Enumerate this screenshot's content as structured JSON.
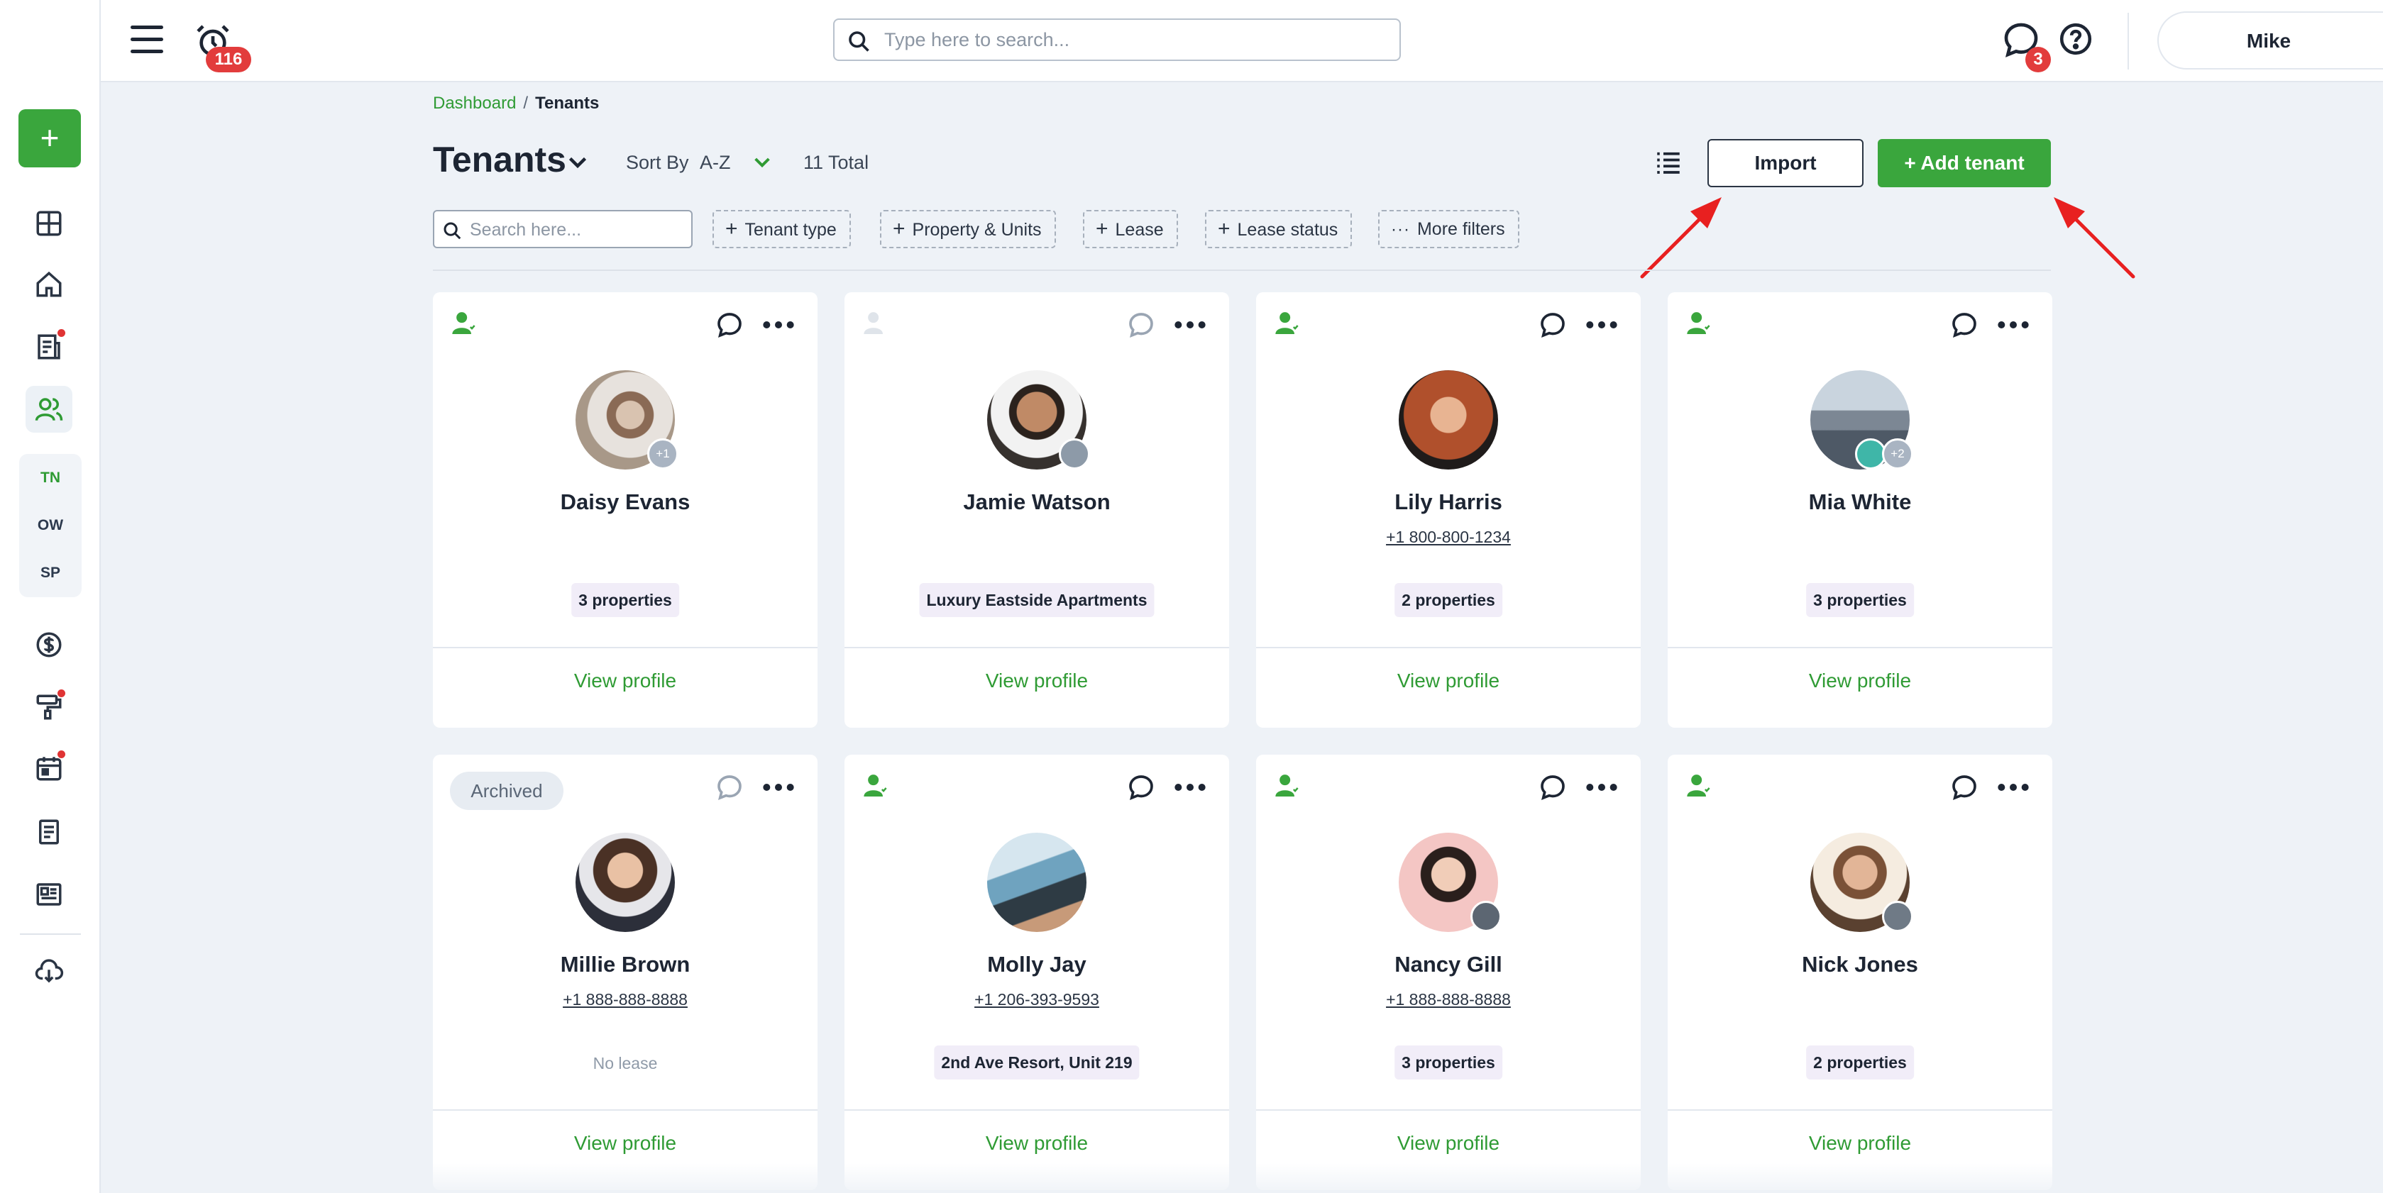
{
  "topbar": {
    "alarm_count": "116",
    "search_placeholder": "Type here to search...",
    "messages_count": "3",
    "user_name": "Mike"
  },
  "sidebar": {
    "add_label": "+",
    "sub_items": [
      "TN",
      "OW",
      "SP"
    ]
  },
  "breadcrumb": {
    "root": "Dashboard",
    "sep": "/",
    "current": "Tenants"
  },
  "header": {
    "title": "Tenants",
    "sort_label": "Sort By",
    "sort_value": "A-Z",
    "total": "11 Total",
    "import_label": "Import",
    "add_label": "+  Add tenant"
  },
  "filters": {
    "search_placeholder": "Search here...",
    "chips": [
      "Tenant type",
      "Property & Units",
      "Lease",
      "Lease status",
      "More filters"
    ]
  },
  "cards": [
    {
      "name": "Daisy Evans",
      "phone": "",
      "tag": "3 properties",
      "extra": "+1",
      "archived": false,
      "active": true,
      "view": "View profile"
    },
    {
      "name": "Jamie Watson",
      "phone": "",
      "tag": "Luxury Eastside Apartments",
      "extra": "",
      "archived": false,
      "active": false,
      "view": "View profile"
    },
    {
      "name": "Lily Harris",
      "phone": "+1 800-800-1234",
      "tag": "2 properties",
      "extra": "",
      "archived": false,
      "active": true,
      "view": "View profile"
    },
    {
      "name": "Mia White",
      "phone": "",
      "tag": "3 properties",
      "extra": "+2",
      "archived": false,
      "active": true,
      "view": "View profile"
    },
    {
      "name": "Millie Brown",
      "phone": "+1 888-888-8888",
      "tag": "",
      "no_lease": "No lease",
      "archived": true,
      "archived_label": "Archived",
      "view": "View profile"
    },
    {
      "name": "Molly Jay",
      "phone": "+1 206-393-9593",
      "tag": "2nd Ave Resort, Unit 219",
      "archived": false,
      "active": true,
      "view": "View profile"
    },
    {
      "name": "Nancy Gill",
      "phone": "+1 888-888-8888",
      "tag": "3 properties",
      "archived": false,
      "active": true,
      "view": "View profile"
    },
    {
      "name": "Nick Jones",
      "phone": "",
      "tag": "2 properties",
      "archived": false,
      "active": true,
      "view": "View profile"
    }
  ],
  "colors": {
    "accent": "#3aa63d",
    "badge": "#e23c3c",
    "arrow": "#e82020"
  }
}
